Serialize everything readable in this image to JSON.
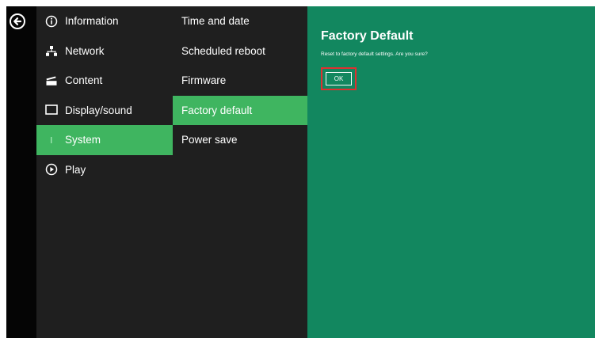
{
  "nav": {
    "back_icon": "arrow-left-circle-icon",
    "categories": [
      {
        "label": "Information",
        "icon": "info-circle-icon"
      },
      {
        "label": "Network",
        "icon": "network-icon"
      },
      {
        "label": "Content",
        "icon": "clapperboard-icon"
      },
      {
        "label": "Display/sound",
        "icon": "monitor-icon"
      },
      {
        "label": "System",
        "icon": "system-icon",
        "active": true
      },
      {
        "label": "Play",
        "icon": "play-circle-icon"
      }
    ],
    "system_items": [
      {
        "label": "Time and date"
      },
      {
        "label": "Scheduled reboot"
      },
      {
        "label": "Firmware"
      },
      {
        "label": "Factory default",
        "active": true
      },
      {
        "label": "Power save"
      }
    ]
  },
  "panel": {
    "title": "Factory Default",
    "message": "Reset to factory default settings. Are you sure?",
    "ok_label": "OK"
  },
  "colors": {
    "background": "#1f1f1f",
    "rail": "#050505",
    "active": "#3fb560",
    "panel": "#12875f",
    "highlight": "#e03030"
  }
}
